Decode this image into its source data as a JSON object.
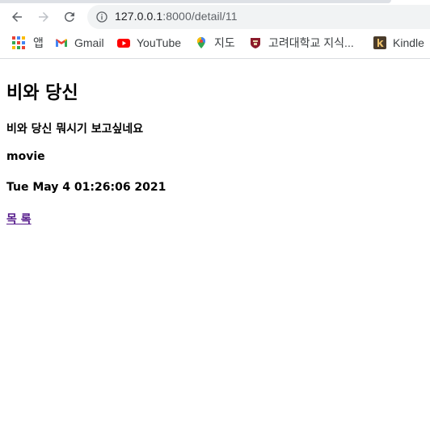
{
  "browser": {
    "url_host": "127.0.0.1",
    "url_path": ":8000/detail/11",
    "bookmarks": [
      {
        "label": "앱",
        "icon": "apps-icon"
      },
      {
        "label": "Gmail",
        "icon": "gmail-icon"
      },
      {
        "label": "YouTube",
        "icon": "youtube-icon"
      },
      {
        "label": "지도",
        "icon": "maps-icon"
      },
      {
        "label": "고려대학교 지식...",
        "icon": "korea-university-icon"
      },
      {
        "label": "Kindle",
        "icon": "kindle-icon"
      }
    ]
  },
  "detail": {
    "title": "비와 당신",
    "content": "비와 당신 뭐시기 보고싶네요",
    "category": "movie",
    "date": "Tue May 4 01:26:06 2021",
    "list_link": "목 록"
  }
}
